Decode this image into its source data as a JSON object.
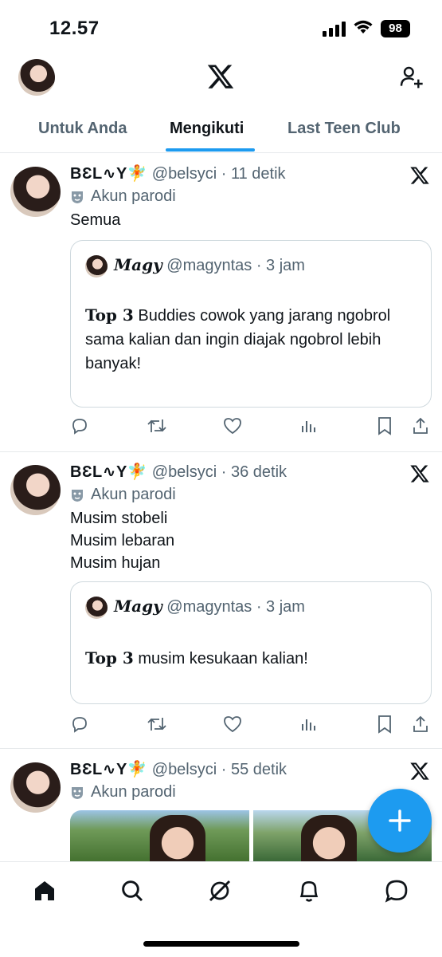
{
  "status_bar": {
    "time": "12.57",
    "battery": "98"
  },
  "tabs": [
    {
      "label": "Untuk Anda",
      "active": false
    },
    {
      "label": "Mengikuti",
      "active": true
    },
    {
      "label": "Last Teen Club",
      "active": false
    }
  ],
  "posts": [
    {
      "display_name": "BƐL∿Y🧚",
      "meta": " @belsyci · 11 detik",
      "parody_label": "Akun parodi",
      "body_lines": [
        "Semua"
      ],
      "quote": {
        "name": "Magy",
        "meta": " @magyntas · 3 jam",
        "bold": "Top 3",
        "text": " Buddies cowok yang jarang ngobrol sama kalian dan ingin diajak ngobrol lebih banyak!"
      }
    },
    {
      "display_name": "BƐL∿Y🧚",
      "meta": " @belsyci · 36 detik",
      "parody_label": "Akun parodi",
      "body_lines": [
        "Musim stobeli",
        "Musim lebaran",
        "Musim hujan"
      ],
      "quote": {
        "name": "Magy",
        "meta": " @magyntas · 3 jam",
        "bold": "Top 3",
        "text": " musim kesukaan kalian!"
      }
    },
    {
      "display_name": "BƐL∿Y🧚",
      "meta": " @belsyci · 55 detik",
      "parody_label": "Akun parodi"
    }
  ],
  "icons": {
    "action_bar": [
      "reply-icon",
      "retweet-icon",
      "like-icon",
      "views-icon",
      "bookmark-icon",
      "share-icon"
    ],
    "bottom_nav": [
      "home-icon",
      "search-icon",
      "grok-icon",
      "notifications-icon",
      "messages-icon"
    ]
  },
  "colors": {
    "accent": "#1d9bf0",
    "secondary_text": "#536471",
    "text": "#0f1419"
  }
}
